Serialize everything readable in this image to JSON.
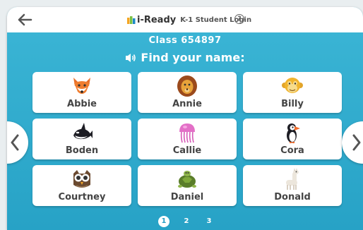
{
  "header": {
    "back_icon": "back-arrow-icon",
    "brand": "i-Ready",
    "title": "K-1 Student Login",
    "help_label": "?"
  },
  "class_label": "Class 654897",
  "prompt": "Find your name:",
  "students": [
    {
      "name": "Abbie",
      "icon": "fox-icon"
    },
    {
      "name": "Annie",
      "icon": "lion-icon"
    },
    {
      "name": "Billy",
      "icon": "monkey-icon"
    },
    {
      "name": "Boden",
      "icon": "orca-icon"
    },
    {
      "name": "Callie",
      "icon": "jellyfish-icon"
    },
    {
      "name": "Cora",
      "icon": "puffin-icon"
    },
    {
      "name": "Courtney",
      "icon": "owl-icon"
    },
    {
      "name": "Daniel",
      "icon": "turtle-icon"
    },
    {
      "name": "Donald",
      "icon": "llama-icon"
    }
  ],
  "pagination": {
    "pages": [
      "1",
      "2",
      "3"
    ],
    "current": "1"
  },
  "colors": {
    "accent": "#2aa6c9",
    "card": "#ffffff",
    "text": "#444444"
  }
}
